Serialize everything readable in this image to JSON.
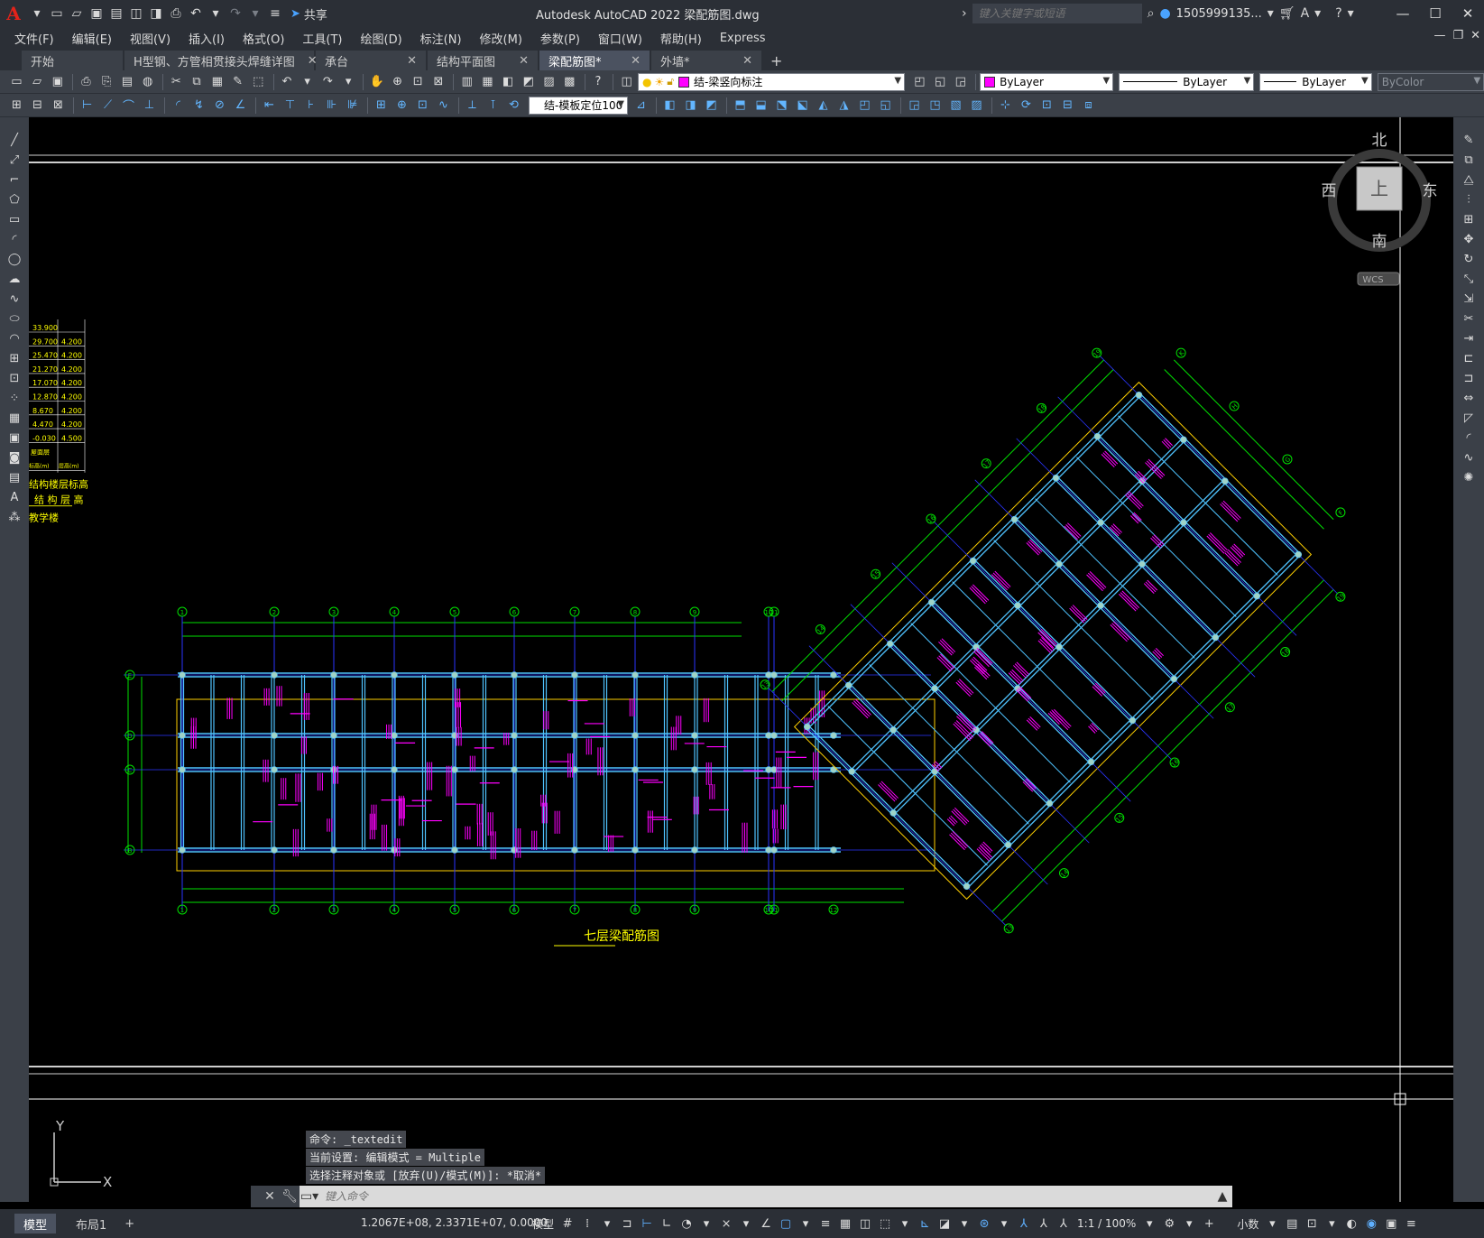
{
  "app": {
    "title": "Autodesk AutoCAD 2022    梁配筋图.dwg",
    "logo": "A",
    "share_label": "共享"
  },
  "search": {
    "placeholder": "键入关键字或短语"
  },
  "user": {
    "name": "1505999135..."
  },
  "menu": [
    "文件(F)",
    "编辑(E)",
    "视图(V)",
    "插入(I)",
    "格式(O)",
    "工具(T)",
    "绘图(D)",
    "标注(N)",
    "修改(M)",
    "参数(P)",
    "窗口(W)",
    "帮助(H)",
    "Express"
  ],
  "tabs": [
    {
      "label": "开始",
      "active": false,
      "closable": false
    },
    {
      "label": "H型钢、方管相贯接头焊缝详图",
      "active": false,
      "closable": true
    },
    {
      "label": "承台",
      "active": false,
      "closable": true
    },
    {
      "label": "结构平面图",
      "active": false,
      "closable": true
    },
    {
      "label": "梁配筋图*",
      "active": true,
      "closable": true
    },
    {
      "label": "外墙*",
      "active": false,
      "closable": true
    }
  ],
  "toolbar": {
    "layer": "结-梁竖向标注",
    "color": "ByLayer",
    "linetype": "ByLayer",
    "lineweight": "ByLayer",
    "plotstyle": "ByColor",
    "text_style": "结-模板定位100",
    "layer_color": "#ff00ff"
  },
  "viewcube": {
    "north": "北",
    "south": "南",
    "east": "东",
    "west": "西",
    "top": "上",
    "wcs": "WCS"
  },
  "ucs": {
    "x": "X",
    "y": "Y"
  },
  "drawing": {
    "title": "七层梁配筋图",
    "level_table": {
      "rows": [
        [
          "33.900",
          ""
        ],
        [
          "29.700",
          "4.200"
        ],
        [
          "25.470",
          "4.200"
        ],
        [
          "21.270",
          "4.200"
        ],
        [
          "17.070",
          "4.200"
        ],
        [
          "12.870",
          "4.200"
        ],
        [
          "8.670",
          "4.200"
        ],
        [
          "4.470",
          "4.200"
        ],
        [
          "-0.030",
          "4.500"
        ]
      ],
      "footer": [
        "屋面层",
        "标高(m)",
        "层高(m)"
      ],
      "caption1": "结构楼层标高",
      "caption2": "结 构 层 高",
      "caption3": "教学楼"
    },
    "axes_top": [
      "1",
      "2",
      "3",
      "4",
      "5",
      "6",
      "7",
      "8",
      "9",
      "10",
      "11"
    ],
    "axes_bottom": [
      "1",
      "2",
      "3",
      "4",
      "5",
      "6",
      "7",
      "8",
      "9",
      "10",
      "11",
      "12"
    ],
    "axes_left": [
      "E",
      "D",
      "C",
      "B"
    ],
    "axes_rotated": [
      "13",
      "14",
      "15",
      "16",
      "17",
      "18",
      "19"
    ],
    "axes_rotated_letters": [
      "K",
      "H",
      "G",
      "F"
    ]
  },
  "command": {
    "history": [
      "命令: _textedit",
      "当前设置: 编辑模式 = Multiple",
      "选择注释对象或 [放弃(U)/模式(M)]: *取消*"
    ],
    "placeholder": "键入命令"
  },
  "status": {
    "layouts": [
      {
        "label": "模型",
        "active": true
      },
      {
        "label": "布局1",
        "active": false
      }
    ],
    "coords": "1.2067E+08, 2.3371E+07, 0.0000",
    "model_label": "模型",
    "scale": "1:1 / 100%",
    "units": "小数"
  },
  "colors": {
    "beam": "#4fc3ff",
    "grid_axis": "#2a35ff",
    "dimension": "#00e000",
    "annotation": "#ff00ff",
    "outline": "#ffd000",
    "label_text": "#ffff00"
  }
}
